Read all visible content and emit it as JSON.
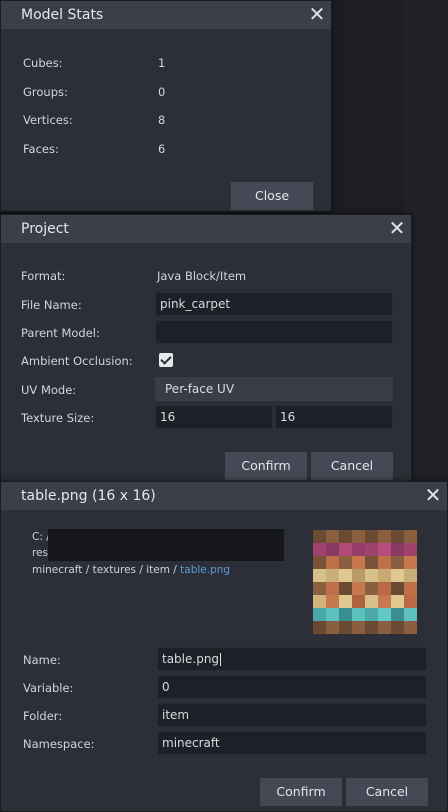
{
  "model_stats": {
    "title": "Model Stats",
    "rows": [
      {
        "label": "Cubes:",
        "value": "1"
      },
      {
        "label": "Groups:",
        "value": "0"
      },
      {
        "label": "Vertices:",
        "value": "8"
      },
      {
        "label": "Faces:",
        "value": "6"
      }
    ],
    "close_button": "Close"
  },
  "project": {
    "title": "Project",
    "format_label": "Format:",
    "format_value": "Java Block/Item",
    "file_name_label": "File Name:",
    "file_name_value": "pink_carpet",
    "parent_model_label": "Parent Model:",
    "parent_model_value": "",
    "ambient_occlusion_label": "Ambient Occlusion:",
    "ambient_occlusion_checked": true,
    "uv_mode_label": "UV Mode:",
    "uv_mode_value": "Per-face UV",
    "texture_size_label": "Texture Size:",
    "texture_width": "16",
    "texture_height": "16",
    "confirm_button": "Confirm",
    "cancel_button": "Cancel"
  },
  "texture": {
    "title": "table.png (16 x 16)",
    "path_line1_prefix": "C: /",
    "path_line2_prefix": "res",
    "path_line3": "minecraft / textures / item / ",
    "path_file": "table.png",
    "name_label": "Name:",
    "name_value": "table.png",
    "variable_label": "Variable:",
    "variable_value": "0",
    "folder_label": "Folder:",
    "folder_value": "item",
    "namespace_label": "Namespace:",
    "namespace_value": "minecraft",
    "confirm_button": "Confirm",
    "cancel_button": "Cancel"
  },
  "colors": {
    "link": "#5e9ad6",
    "dialog_bg": "#2c2f37",
    "title_bg": "#3b3f49"
  },
  "icons": [
    "close-icon",
    "checkmark-icon",
    "texture-thumbnail"
  ]
}
